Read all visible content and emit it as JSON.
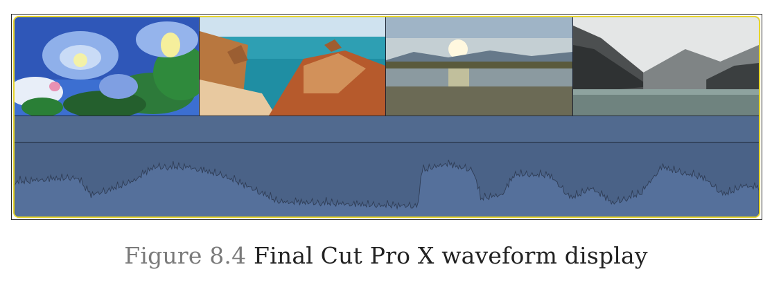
{
  "caption": {
    "label": "Figure 8.4",
    "text": "Final Cut Pro X waveform display"
  },
  "colors": {
    "selection_border": "#e9d62c",
    "track_fill": "#4a6287",
    "waveform_stroke": "#2f3d56",
    "waveform_fill": "#55709b"
  },
  "thumbnails": [
    {
      "subject": "blue morning glory flowers"
    },
    {
      "subject": "coastal rock formations and turquoise sea"
    },
    {
      "subject": "sunset over reedy lake"
    },
    {
      "subject": "black and white mountain lake"
    }
  ]
}
